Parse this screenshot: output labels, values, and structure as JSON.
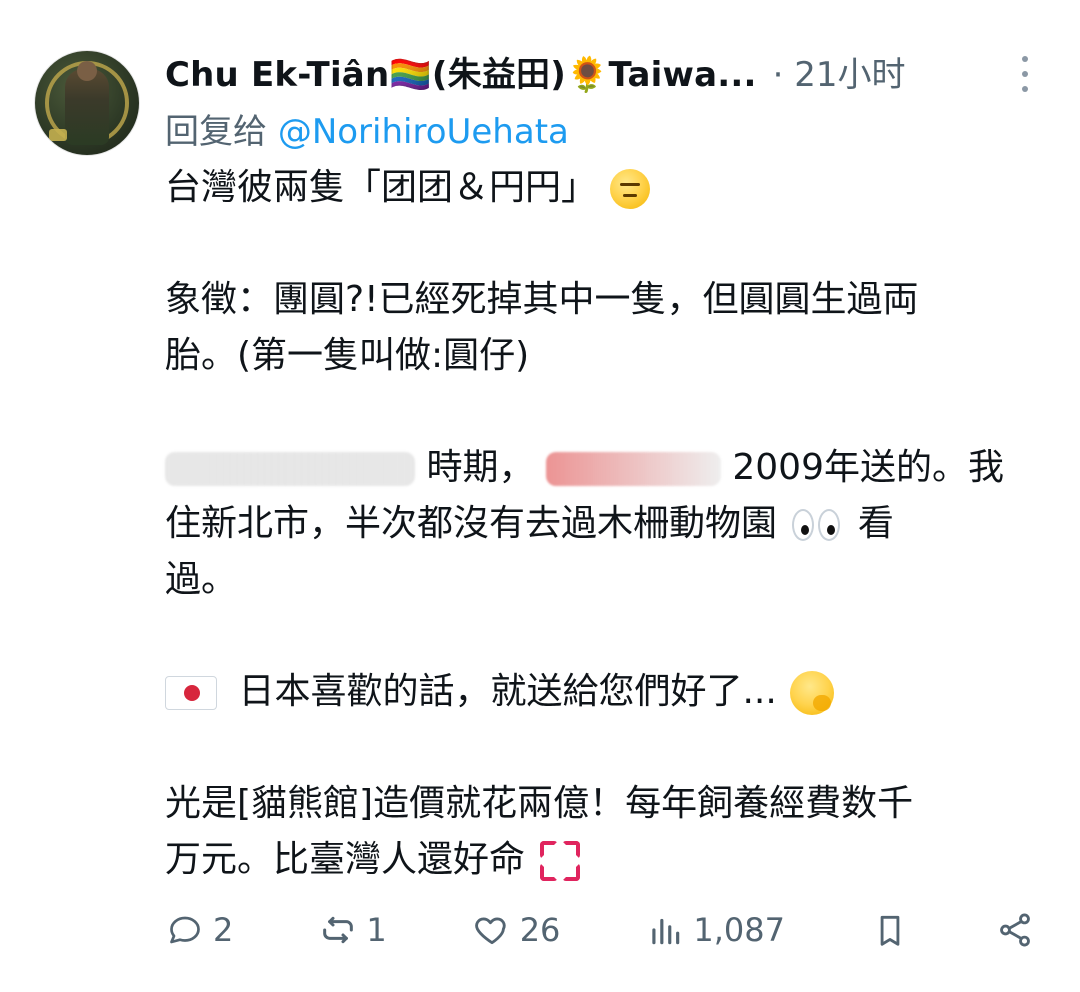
{
  "tweet": {
    "author": {
      "display_name": "Chu Ek-Tiân🏳️‍🌈(朱益田)🌻Taiwa...",
      "avatar": "avatar"
    },
    "meta": "· 21小时",
    "reply": {
      "prefix": "回复给",
      "handle": "@NorihiroUehata"
    },
    "body": {
      "p1": "台灣彼兩隻「团团＆円円」",
      "p2a": "象徵：團圓?!已經死掉其中一隻，但圓圓生過両",
      "p2b": "胎。(第一隻叫做:圓仔)",
      "p3_line1_mid": "時期，",
      "p3_line1_end": "2009年送的。我",
      "p3_line2": "住新北市，半次都沒有去過木柵動物園",
      "p3_line2_end": "看",
      "p3_line3": "過。",
      "p4": "日本喜歡的話，就送給您們好了...",
      "p5a": "光是[貓熊館]造價就花兩億！每年飼養經費数千",
      "p5b": "万元。比臺灣人還好命"
    },
    "actions": {
      "reply_count": "2",
      "retweet_count": "1",
      "like_count": "26",
      "views_count": "1,087"
    }
  },
  "icons": {
    "more": "more-icon",
    "reply": "reply-icon",
    "retweet": "retweet-icon",
    "like": "heart-icon",
    "views": "views-icon",
    "bookmark": "bookmark-icon",
    "share": "share-icon",
    "flag": "japan-flag-icon",
    "emoji1": "expressionless-face-icon",
    "emoji2": "eyes-icon",
    "emoji3": "hand-over-mouth-icon",
    "emoji4": "anger-symbol-icon"
  },
  "colors": {
    "link": "#1d9bf0",
    "secondary_text": "#536471",
    "primary_text": "#0f1419"
  }
}
